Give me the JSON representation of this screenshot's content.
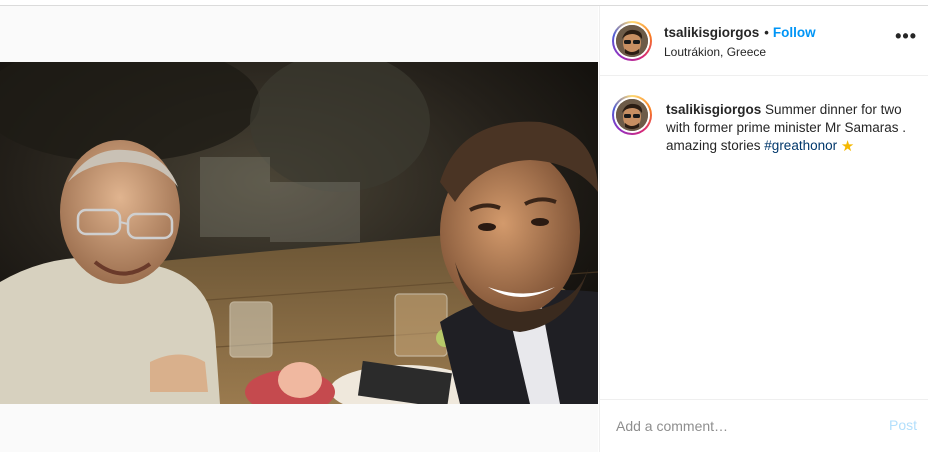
{
  "post": {
    "photo_alt": "Two men smiling at a restaurant table at night",
    "author": {
      "username": "tsalikisgiorgos",
      "location": "Loutrákion, Greece",
      "follow_label": "Follow",
      "dot": "•"
    },
    "more_label": "•••",
    "caption": {
      "username": "tsalikisgiorgos",
      "text": "Summer dinner for two with former prime minister Mr Samaras .",
      "line2": "amazing stories ",
      "hashtag": "#greathonor",
      "emoji": "★"
    },
    "comment": {
      "placeholder": "Add a comment…",
      "post_label": "Post"
    }
  },
  "colors": {
    "link": "#0095f6",
    "hashtag": "#00376b",
    "post_disabled": "#b2dffc",
    "border": "#efefef"
  }
}
